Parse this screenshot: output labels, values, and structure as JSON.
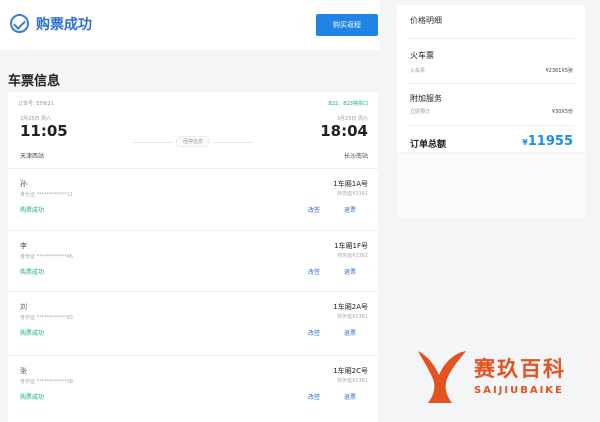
{
  "header": {
    "title": "购票成功",
    "buy_return_label": "购买返程"
  },
  "ticket_section_title": "车票信息",
  "trip": {
    "order_no": "订单号: E5W21",
    "seat_info": "B22、B23特票口",
    "dep_date": "3月25日 周六",
    "dep_time": "11:05",
    "dep_station": "天津西站",
    "stop_info": "经停信息",
    "arr_date": "3月25日 周六",
    "arr_time": "18:04",
    "arr_station": "长沙南站"
  },
  "passengers": [
    {
      "name": "孙",
      "id": "身份证   ************11",
      "status": "购票成功",
      "seat": "1车厢1A号",
      "price": "商务座¥2361",
      "change": "改签",
      "refund": "退票"
    },
    {
      "name": "李",
      "id": "身份证   ************46",
      "status": "购票成功",
      "seat": "1车厢1F号",
      "price": "商务座¥2361",
      "change": "改签",
      "refund": "退票"
    },
    {
      "name": "刘",
      "id": "身份证   ************93",
      "status": "购票成功",
      "seat": "1车厢2A号",
      "price": "商务座¥2361",
      "change": "改签",
      "refund": "退票"
    },
    {
      "name": "张",
      "id": "身份证   ************38",
      "status": "购票成功",
      "seat": "1车厢2C号",
      "price": "商务座¥2361",
      "change": "改签",
      "refund": "退票"
    }
  ],
  "price_detail": {
    "title": "价格明细",
    "train_title": "火车票",
    "train_label": "火车票",
    "train_value": "¥2361X5张",
    "service_title": "附加服务",
    "service_label": "立即预订",
    "service_value": "¥30X5份",
    "total_label": "订单总额",
    "total_currency": "¥",
    "total_value": "11955"
  },
  "watermark": {
    "cn": "赛玖百科",
    "en": "SAIJIUBAIKE"
  },
  "colors": {
    "primary": "#1f84e6",
    "success_green": "#1cad7a",
    "total_blue": "#1a8fe3",
    "watermark_orange": "#e2531f"
  }
}
